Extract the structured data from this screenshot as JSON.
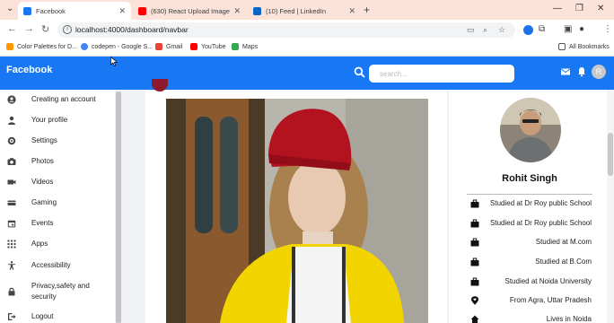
{
  "browser": {
    "tabs": [
      {
        "title": "Facebook",
        "active": true,
        "favicon": "facebook-icon",
        "favicon_color": "#1877f2"
      },
      {
        "title": "(630) React Upload Image and",
        "active": false,
        "favicon": "youtube-icon",
        "favicon_color": "#ff0000"
      },
      {
        "title": "(10) Feed | LinkedIn",
        "active": false,
        "favicon": "linkedin-icon",
        "favicon_color": "#0a66c2"
      }
    ],
    "new_tab": "+",
    "url": "localhost:4000/dashboard/navbar",
    "bookmarks": [
      {
        "label": "Color Palettes for D...",
        "color": "#ff9800"
      },
      {
        "label": "codepen - Google S...",
        "color": "#4285f4"
      },
      {
        "label": "Gmail",
        "color": "#ea4335"
      },
      {
        "label": "YouTube",
        "color": "#ff0000"
      },
      {
        "label": "Maps",
        "color": "#34a853"
      }
    ],
    "all_bookmarks": "All Bookmarks",
    "profile_initial": "R"
  },
  "navbar": {
    "brand": "Facebook",
    "search_placeholder": "search...",
    "avatar_initial": "R",
    "color": "#1877f2"
  },
  "sidebar": {
    "items": [
      {
        "label": "Creating an account",
        "icon": "account-circle-icon"
      },
      {
        "label": "Your profile",
        "icon": "person-icon"
      },
      {
        "label": "Settings",
        "icon": "gear-icon"
      },
      {
        "label": "Photos",
        "icon": "camera-icon"
      },
      {
        "label": "Videos",
        "icon": "video-icon"
      },
      {
        "label": "Gaming",
        "icon": "gamepad-icon"
      },
      {
        "label": "Events",
        "icon": "calendar-icon"
      },
      {
        "label": "Apps",
        "icon": "apps-grid-icon"
      },
      {
        "label": "Accessibility",
        "icon": "accessibility-icon"
      },
      {
        "label": "Privacy,safety and security",
        "icon": "lock-icon"
      },
      {
        "label": "Logout",
        "icon": "logout-icon"
      }
    ]
  },
  "profile": {
    "name": "Rohit Singh",
    "info": [
      {
        "text": "Studied at Dr Roy public School",
        "icon": "briefcase-icon"
      },
      {
        "text": "Studied at Dr Roy public School",
        "icon": "briefcase-icon"
      },
      {
        "text": "Studied at M.com",
        "icon": "briefcase-icon"
      },
      {
        "text": "Studied at B.Com",
        "icon": "briefcase-icon"
      },
      {
        "text": "Studied at Noida University",
        "icon": "briefcase-icon"
      },
      {
        "text": "From Agra, Uttar Pradesh",
        "icon": "location-heart-icon"
      },
      {
        "text": "Lives in Noida",
        "icon": "home-icon"
      }
    ]
  }
}
